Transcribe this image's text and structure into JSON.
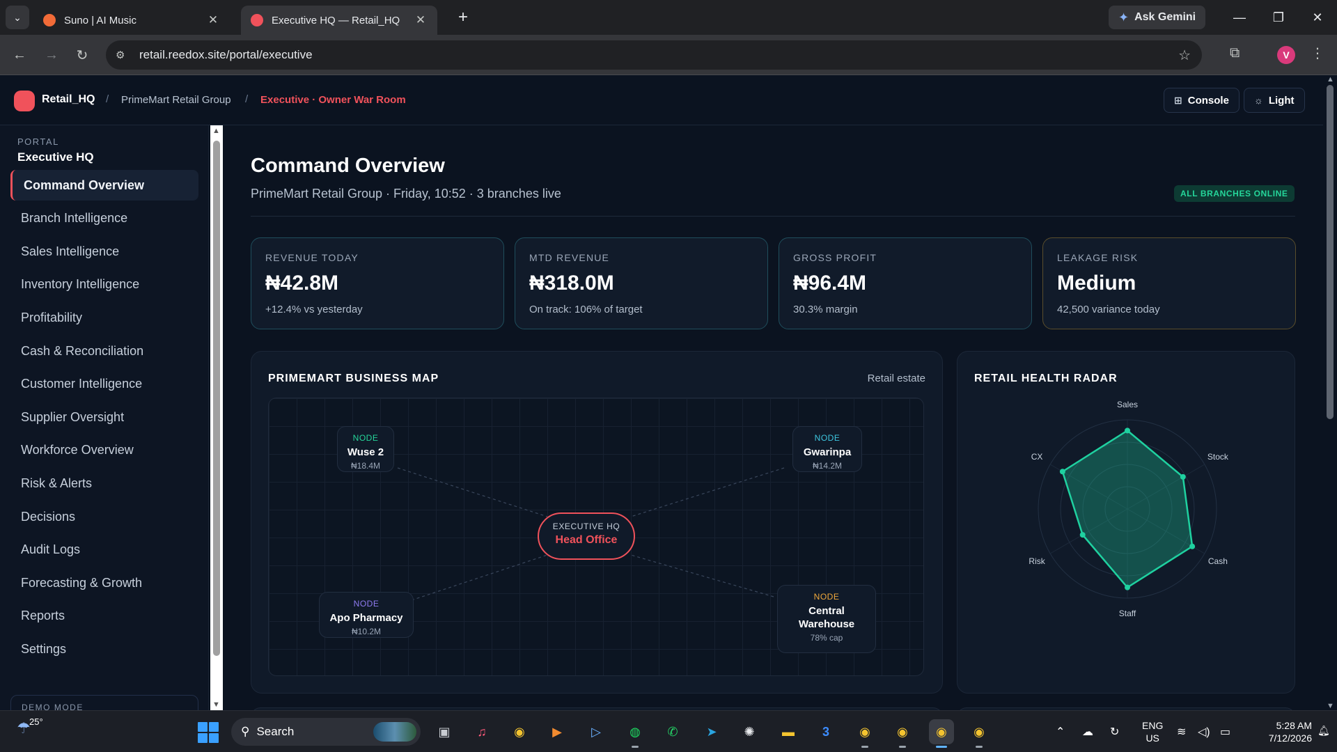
{
  "browser": {
    "tabs": [
      {
        "title": "Suno | AI Music",
        "favicon_color": "#f26b38"
      },
      {
        "title": "Executive HQ — Retail_HQ",
        "favicon_color": "#f0525b"
      }
    ],
    "url": "retail.reedox.site/portal/executive",
    "gemini_label": "Ask Gemini",
    "profile_initial": "V"
  },
  "app": {
    "brand": "Retail_HQ",
    "breadcrumb": [
      "PrimeMart Retail Group",
      "Executive · Owner War Room"
    ],
    "buttons": {
      "console": "Console",
      "theme": "Light"
    },
    "accent": "#f0525b"
  },
  "sidebar": {
    "section_label": "PORTAL",
    "portal_name": "Executive HQ",
    "items": [
      {
        "label": "Command Overview",
        "active": true
      },
      {
        "label": "Branch Intelligence"
      },
      {
        "label": "Sales Intelligence"
      },
      {
        "label": "Inventory Intelligence"
      },
      {
        "label": "Profitability"
      },
      {
        "label": "Cash & Reconciliation"
      },
      {
        "label": "Customer Intelligence"
      },
      {
        "label": "Supplier Oversight"
      },
      {
        "label": "Workforce Overview"
      },
      {
        "label": "Risk & Alerts"
      },
      {
        "label": "Decisions"
      },
      {
        "label": "Audit Logs"
      },
      {
        "label": "Forecasting & Growth"
      },
      {
        "label": "Reports"
      },
      {
        "label": "Settings"
      }
    ],
    "demo_label": "DEMO MODE"
  },
  "main": {
    "title": "Command Overview",
    "subtitle": "PrimeMart Retail Group · Friday, 10:52 · 3 branches live",
    "status_badge": "ALL BRANCHES ONLINE",
    "kpis": [
      {
        "label": "REVENUE TODAY",
        "value": "₦42.8M",
        "note": "+12.4% vs yesterday"
      },
      {
        "label": "MTD REVENUE",
        "value": "₦318.0M",
        "note": "On track: 106% of target"
      },
      {
        "label": "GROSS PROFIT",
        "value": "₦96.4M",
        "note": "30.3% margin"
      },
      {
        "label": "LEAKAGE RISK",
        "value": "Medium",
        "note": "42,500 variance today"
      }
    ],
    "map": {
      "title": "PRIMEMART BUSINESS MAP",
      "aside": "Retail estate",
      "hq": {
        "tag": "EXECUTIVE HQ",
        "name": "Head Office"
      },
      "nodes": [
        {
          "tag": "NODE",
          "name": "Wuse 2",
          "amount": "₦18.4M",
          "tag_color": "#25d69a"
        },
        {
          "tag": "NODE",
          "name": "Gwarinpa",
          "amount": "₦14.2M",
          "tag_color": "#3ec7e0"
        },
        {
          "tag": "NODE",
          "name": "Apo Pharmacy",
          "amount": "₦10.2M",
          "tag_color": "#8f7bf0"
        },
        {
          "tag": "NODE",
          "name": "Central Warehouse",
          "amount": "78% cap",
          "tag_color": "#f0a93c"
        }
      ]
    },
    "radar": {
      "title": "RETAIL HEALTH RADAR",
      "axes": [
        "Sales",
        "Stock",
        "Cash",
        "Staff",
        "Risk",
        "CX"
      ],
      "values": [
        0.88,
        0.72,
        0.84,
        0.88,
        0.58,
        0.84
      ],
      "color": "#1fd1a0"
    }
  },
  "taskbar": {
    "temperature": "25°",
    "search_label": "Search",
    "lang": [
      "ENG",
      "US"
    ],
    "time": "5:28 AM",
    "date": "7/12/2026"
  }
}
